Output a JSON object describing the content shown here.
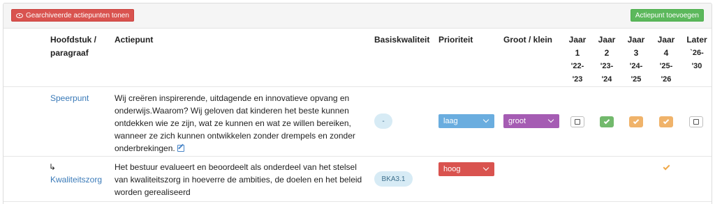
{
  "toolbar": {
    "archived_label": "Gearchiveerde actiepunten tonen",
    "add_label": "Actiepunt toevoegen"
  },
  "columns": {
    "chapter_l1": "Hoofdstuk /",
    "chapter_l2": "paragraaf",
    "action": "Actiepunt",
    "quality": "Basiskwaliteit",
    "priority": "Prioriteit",
    "size": "Groot / klein",
    "years": [
      {
        "l1": "Jaar",
        "l2": "1",
        "l3": "'22-",
        "l4": "'23"
      },
      {
        "l1": "Jaar",
        "l2": "2",
        "l3": "'23-",
        "l4": "'24"
      },
      {
        "l1": "Jaar",
        "l2": "3",
        "l3": "'24-",
        "l4": "'25"
      },
      {
        "l1": "Jaar",
        "l2": "4",
        "l3": "'25-",
        "l4": "'26"
      }
    ],
    "later_l1": "Later",
    "later_l2": "`26-",
    "later_l3": "'30"
  },
  "rows": [
    {
      "chapter": "Speerpunt",
      "text_lines": [
        "Wij creëren inspirerende, uitdagende en innovatieve opvang en",
        "onderwijs.Waarom? Wij geloven dat kinderen het beste kunnen",
        "ontdekken wie ze zijn, wat ze kunnen en wat ze willen bereiken,",
        "wanneer ze zich kunnen ontwikkelen zonder drempels en zonder",
        "onderbrekingen."
      ],
      "quality": "-",
      "priority": "laag",
      "size": "groot",
      "years": [
        "empty",
        "green",
        "orange",
        "orange",
        "empty"
      ]
    },
    {
      "arrow": "↳",
      "chapter": "Kwaliteitszorg",
      "text_lines": [
        "Het bestuur evalueert en beoordeelt als onderdeel van het stelsel",
        "van kwaliteitszorg in hoeverre de ambities, de doelen en het beleid",
        "worden gerealiseerd"
      ],
      "quality": "BKA3.1",
      "priority": "hoog",
      "years": [
        "",
        "",
        "",
        "check",
        ""
      ]
    }
  ],
  "colors": {
    "danger": "#d9534f",
    "success": "#5cb85c",
    "link": "#3a7ab8",
    "priority_low": "#6aaddf",
    "size_large": "#a55cb3"
  }
}
